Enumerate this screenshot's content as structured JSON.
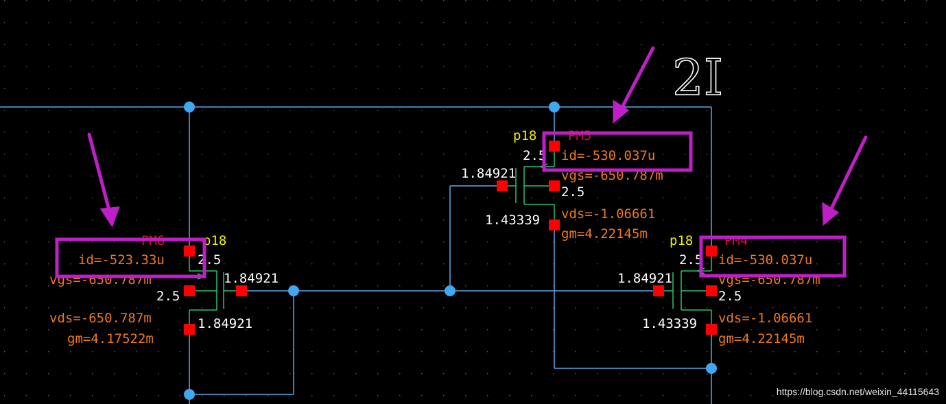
{
  "colors": {
    "background": "#000000",
    "wire": "#5aa8e8",
    "device": "#27c46a",
    "pin": "#ff0000",
    "net_value": "#ffffff",
    "op_param": "#f0781e",
    "model_label": "#f0f000",
    "instance_label": "#d41a1a",
    "highlight": "#c01ec8"
  },
  "annotation": {
    "handwritten_label": "2I"
  },
  "devices": {
    "pm6": {
      "instance": "PM6",
      "model": "p18",
      "id": "id=-523.33u",
      "vgs": "vgs=-650.787m",
      "vds": "vds=-650.787m",
      "gm": "gm=4.17522m",
      "pin_source": "2.5",
      "pin_bulk": "2.5",
      "pin_gate": "1.84921",
      "pin_drain": "1.84921"
    },
    "pm5": {
      "instance": "PM5",
      "model": "p18",
      "id": "id=-530.037u",
      "vgs": "vgs=-650.787m",
      "vds": "vds=-1.06661",
      "gm": "gm=4.22145m",
      "pin_source": "2.5",
      "pin_bulk": "2.5",
      "pin_gate": "1.84921",
      "pin_drain": "1.43339"
    },
    "pm4": {
      "instance": "PM4",
      "model": "p18",
      "id": "id=-530.037u",
      "vgs": "vgs=-650.787m",
      "vds": "vds=-1.06661",
      "gm": "gm=4.22145m",
      "pin_source": "2.5",
      "pin_bulk": "2.5",
      "pin_gate": "1.84921",
      "pin_drain": "1.43339"
    }
  },
  "watermark": "https://blog.csdn.net/weixin_44115643"
}
